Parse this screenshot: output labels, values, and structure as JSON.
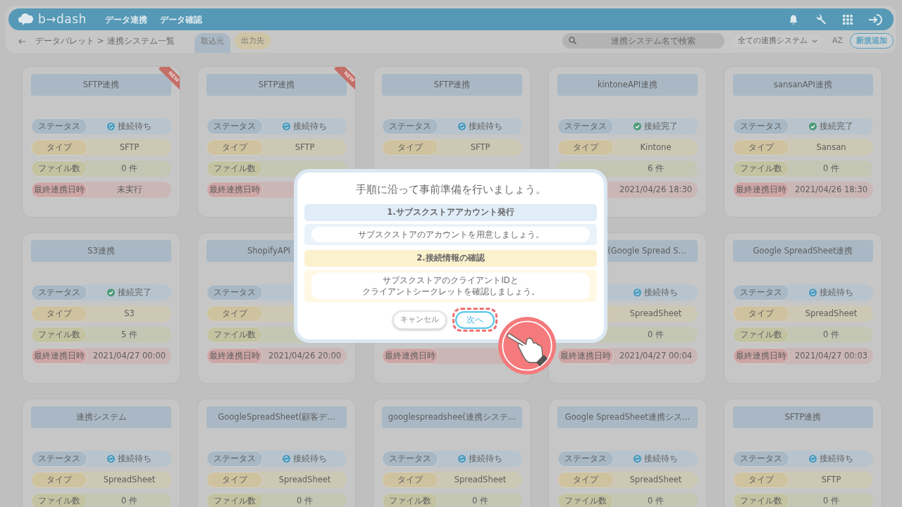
{
  "header": {
    "logo": "b→dash",
    "nav": [
      "データ連携",
      "データ確認"
    ]
  },
  "toolbar": {
    "breadcrumb": "データパレット > 連携システム一覧",
    "tabs": [
      {
        "label": "取込元",
        "selected": true
      },
      {
        "label": "出力先",
        "selected": false
      }
    ],
    "search": {
      "placeholder": "連携システム名で検索"
    },
    "filter": "全ての連携システム",
    "sort": "AZ",
    "add_button": "新規追加"
  },
  "cards": [
    {
      "kind": "full",
      "title": "SFTP連携",
      "badge": "NEW",
      "rows": [
        {
          "kind": "status",
          "label": "ステータス",
          "value": "接続待ち",
          "connected": false
        },
        {
          "kind": "type",
          "label": "タイプ",
          "value": "SFTP"
        },
        {
          "kind": "files",
          "label": "ファイル数",
          "value": "0 件"
        },
        {
          "kind": "last",
          "label": "最終連携日時",
          "value": "未実行"
        }
      ]
    },
    {
      "kind": "full",
      "title": "SFTP連携",
      "badge": "NEW",
      "rows": [
        {
          "kind": "status",
          "label": "ステータス",
          "value": "接続待ち",
          "connected": false
        },
        {
          "kind": "type",
          "label": "タイプ",
          "value": "SFTP"
        },
        {
          "kind": "files",
          "label": "ファイル数"
        },
        {
          "kind": "last",
          "label": "最終連携日時"
        }
      ]
    },
    {
      "kind": "full",
      "title": "SFTP連携",
      "rows": [
        {
          "kind": "status",
          "label": "ステータス",
          "value": "接続待ち",
          "connected": false
        },
        {
          "kind": "type",
          "label": "タイプ",
          "value": "SFTP"
        }
      ]
    },
    {
      "kind": "full",
      "title": "kintoneAPI連携",
      "rows": [
        {
          "kind": "status",
          "label": "ステータス",
          "value": "接続完了",
          "connected": true
        },
        {
          "kind": "type",
          "label": "タイプ",
          "value": "Kintone"
        },
        {
          "kind": "files",
          "value": "6 件"
        },
        {
          "kind": "last",
          "value": "2021/04/26 18:30"
        }
      ]
    },
    {
      "kind": "full",
      "title": "sansanAPI連携",
      "rows": [
        {
          "kind": "status",
          "label": "ステータス",
          "value": "接続完了",
          "connected": true
        },
        {
          "kind": "type",
          "label": "タイプ",
          "value": "Sansan"
        },
        {
          "kind": "files",
          "label": "ファイル数",
          "value": "0 件"
        },
        {
          "kind": "last",
          "label": "最終連携日時",
          "value": "2021/04/26 18:30"
        }
      ]
    },
    {
      "kind": "full",
      "title": "S3連携",
      "rows": [
        {
          "kind": "status",
          "label": "ステータス",
          "value": "接続完了",
          "connected": true
        },
        {
          "kind": "type",
          "label": "タイプ",
          "value": "S3"
        },
        {
          "kind": "files",
          "label": "ファイル数",
          "value": "5 件"
        },
        {
          "kind": "last",
          "label": "最終連携日時",
          "value": "2021/04/27 00:00"
        }
      ]
    },
    {
      "kind": "cut_right",
      "title": "ShopifyAPI",
      "rows": [
        {
          "kind": "status",
          "label": "ステータス"
        },
        {
          "kind": "type",
          "label": "タイプ"
        },
        {
          "kind": "files",
          "label": "ファイル数"
        },
        {
          "kind": "last",
          "label": "最終連携日時",
          "value": "2021/04/26 20:00"
        }
      ]
    },
    {
      "kind": "hidden",
      "rows": [
        {
          "kind": "last",
          "label": "最終連携日時"
        }
      ]
    },
    {
      "kind": "cut_left",
      "title": "(Google Spread S…",
      "rows": [
        {
          "kind": "status",
          "value": "接続待ち",
          "connected": false
        },
        {
          "kind": "type",
          "value": "SpreadSheet"
        },
        {
          "kind": "files",
          "value": "0 件"
        },
        {
          "kind": "last",
          "label": "最終連携日時",
          "value": "2021/04/27 00:04"
        }
      ]
    },
    {
      "kind": "full",
      "title": "Google SpreadSheet連携",
      "rows": [
        {
          "kind": "status",
          "label": "ステータス",
          "value": "接続待ち",
          "connected": false
        },
        {
          "kind": "type",
          "label": "タイプ",
          "value": "SpreadSheet"
        },
        {
          "kind": "files",
          "label": "ファイル数",
          "value": "0 件"
        },
        {
          "kind": "last",
          "label": "最終連携日時",
          "value": "2021/04/27 00:03"
        }
      ]
    },
    {
      "kind": "full",
      "title": "連携システム",
      "rows": [
        {
          "kind": "status",
          "label": "ステータス",
          "value": "接続待ち",
          "connected": false
        },
        {
          "kind": "type",
          "label": "タイプ",
          "value": "SpreadSheet"
        },
        {
          "kind": "files",
          "label": "ファイル数",
          "value": "0 件"
        }
      ]
    },
    {
      "kind": "full",
      "title": "GoogleSpreadSheet(顧客デ…",
      "rows": [
        {
          "kind": "status",
          "label": "ステータス",
          "value": "接続待ち",
          "connected": false
        },
        {
          "kind": "type",
          "label": "タイプ",
          "value": "SpreadSheet"
        },
        {
          "kind": "files",
          "label": "ファイル数",
          "value": "0 件"
        }
      ]
    },
    {
      "kind": "full",
      "title": "googlespreadshee(連携システ…",
      "rows": [
        {
          "kind": "status",
          "label": "ステータス",
          "value": "接続待ち",
          "connected": false
        },
        {
          "kind": "type",
          "label": "タイプ",
          "value": "SpreadSheet"
        },
        {
          "kind": "files",
          "label": "ファイル数",
          "value": "0 件"
        }
      ]
    },
    {
      "kind": "full",
      "title": "Google SpreadSheet連携シス…",
      "rows": [
        {
          "kind": "status",
          "label": "ステータス",
          "value": "接続待ち",
          "connected": false
        },
        {
          "kind": "type",
          "label": "タイプ",
          "value": "SpreadSheet"
        },
        {
          "kind": "files",
          "label": "ファイル数",
          "value": "0 件"
        }
      ]
    },
    {
      "kind": "full",
      "title": "SFTP連携",
      "rows": [
        {
          "kind": "status",
          "label": "ステータス",
          "value": "接続待ち",
          "connected": false
        },
        {
          "kind": "type",
          "label": "タイプ",
          "value": "SFTP"
        },
        {
          "kind": "files",
          "label": "ファイル数",
          "value": "0 件"
        }
      ]
    }
  ],
  "modal": {
    "title": "手順に沿って事前準備を行いましょう。",
    "steps": [
      {
        "kind": "account",
        "heading": "1.サブスクストアアカウント発行",
        "lines": [
          "サブスクストアのアカウントを用意しましょう。"
        ]
      },
      {
        "kind": "connection",
        "heading": "2.接続情報の確認",
        "lines": [
          "サブスクストアのクライアントIDと",
          "クライアントシークレットを確認しましょう。"
        ]
      }
    ],
    "buttons": [
      {
        "kind": "cancel",
        "label": "キャンセル",
        "highlighted": false
      },
      {
        "kind": "next",
        "label": "次へ",
        "highlighted": true
      }
    ]
  }
}
